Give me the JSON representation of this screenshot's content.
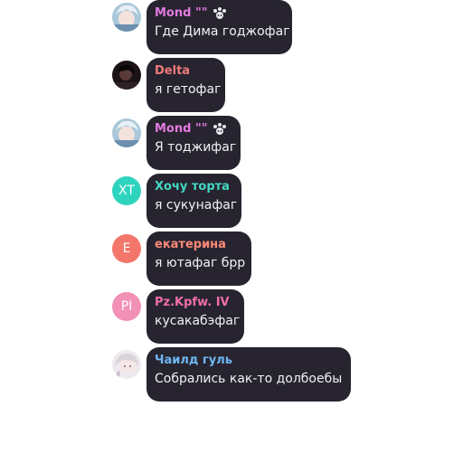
{
  "messages": [
    {
      "author": "Mond \"\"",
      "text": "Где Дима годжофаг",
      "name_color": "#e37adf",
      "avatar": {
        "type": "image",
        "icon": "anime-avatar-icon"
      },
      "badge": "paw-badge-icon"
    },
    {
      "author": "Delta",
      "text": "я гетофаг",
      "name_color": "#f07a7a",
      "avatar": {
        "type": "image",
        "icon": "dark-portrait-avatar-icon"
      }
    },
    {
      "author": "Mond \"\"",
      "text": "Я тоджифаг",
      "name_color": "#e37adf",
      "avatar": {
        "type": "image",
        "icon": "anime-avatar-icon"
      },
      "badge": "paw-badge-icon"
    },
    {
      "author": "Хочу торта",
      "text": "я сукунафаг",
      "name_color": "#43d8c2",
      "avatar": {
        "type": "initials",
        "initials": "XT",
        "color": "#2fd4be"
      }
    },
    {
      "author": "екатерина",
      "text": "я ютафаг брр",
      "name_color": "#ff8a78",
      "avatar": {
        "type": "initials",
        "initials": "E",
        "color": "#f3766b"
      }
    },
    {
      "author": "Pz.Kpfw. IV",
      "text": "кусакабэфаг",
      "name_color": "#f06ea9",
      "avatar": {
        "type": "initials",
        "initials": "PI",
        "color": "#f290b6"
      }
    },
    {
      "author": "Чаилд гуль",
      "text": "Собрались как-то долбоебы",
      "name_color": "#6fb7f2",
      "avatar": {
        "type": "image",
        "icon": "pale-anime-avatar-icon"
      }
    }
  ]
}
